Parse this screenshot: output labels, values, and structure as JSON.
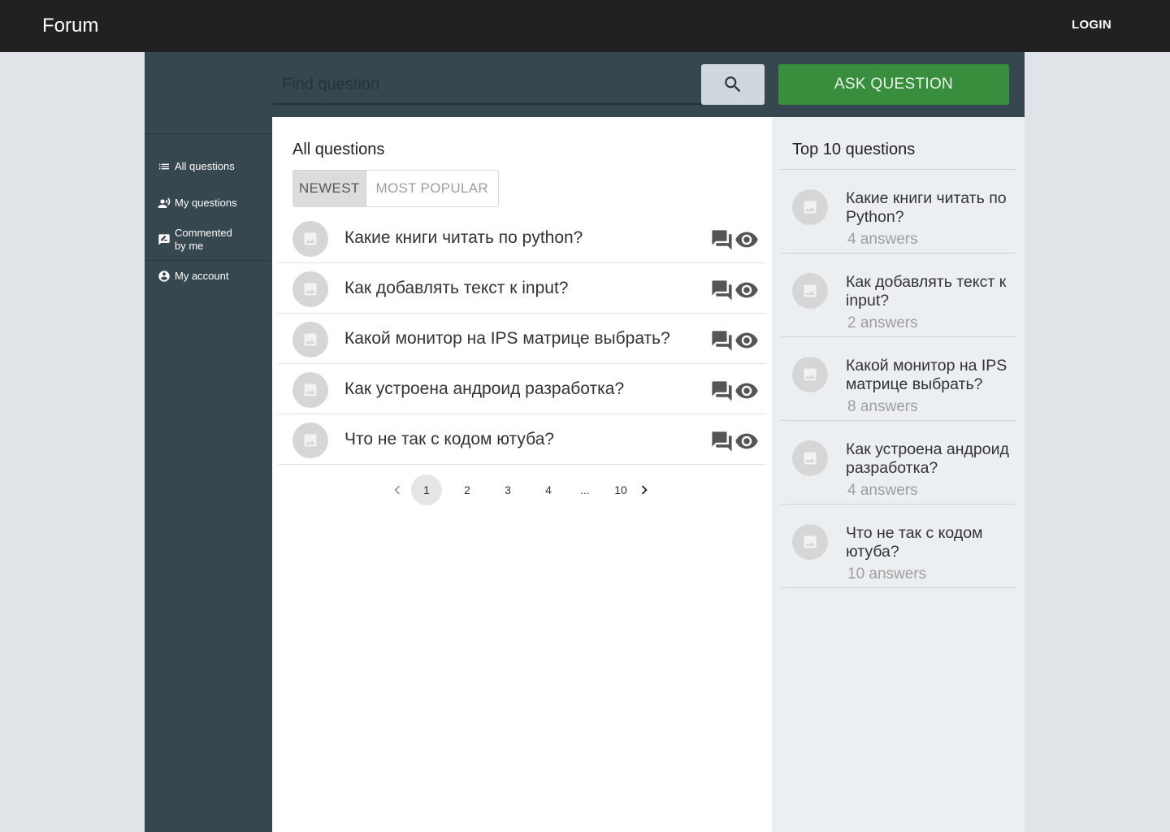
{
  "header": {
    "brand": "Forum",
    "login_label": "LOGIN"
  },
  "search": {
    "placeholder": "Find question",
    "value": ""
  },
  "ask_label": "ASK QUESTION",
  "sidebar": {
    "items": [
      {
        "label": "All questions",
        "icon": "list-icon"
      },
      {
        "label": "My questions",
        "icon": "person-voice-icon"
      },
      {
        "label": "Commented\nby me",
        "icon": "comment-edit-icon"
      },
      {
        "label": "My account",
        "icon": "account-circle-icon"
      }
    ]
  },
  "main": {
    "title": "All questions",
    "sort_options": [
      "NEWEST",
      "MOST POPULAR"
    ],
    "active_sort": "NEWEST",
    "questions": [
      {
        "title": "Какие книги читать по python?"
      },
      {
        "title": "Как добавлять текст к input?"
      },
      {
        "title": "Какой монитор на IPS матрице выбрать?"
      },
      {
        "title": "Как устроена андроид разработка?"
      },
      {
        "title": "Что не так с кодом ютуба?"
      }
    ],
    "pagination": {
      "pages": [
        "1",
        "2",
        "3",
        "4",
        "...",
        "10"
      ],
      "current": "1"
    }
  },
  "top": {
    "title": "Top 10 questions",
    "items": [
      {
        "question": "Какие книги читать по Python?",
        "answers": "4 answers"
      },
      {
        "question": "Как добавлять текст к input?",
        "answers": "2 answers"
      },
      {
        "question": "Какой монитор на IPS матрице выбрать?",
        "answers": "8 answers"
      },
      {
        "question": "Как устроена андроид разработка?",
        "answers": "4 answers"
      },
      {
        "question": "Что не так с кодом ютуба?",
        "answers": "10 answers"
      }
    ]
  },
  "colors": {
    "topbar": "#212121",
    "sidebar": "#37474f",
    "ask_button": "#388e3c",
    "right_panel": "#eceff1"
  }
}
